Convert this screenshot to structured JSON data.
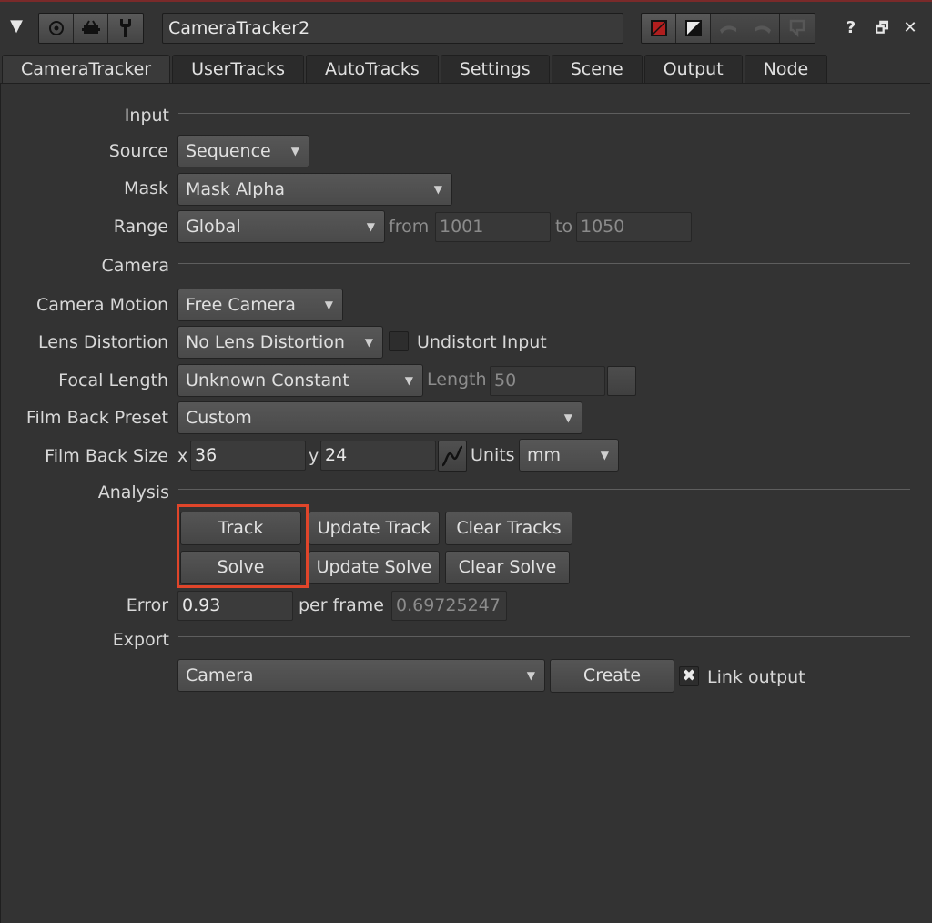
{
  "node_name": "CameraTracker2",
  "toolbar": {
    "collapse_glyph": "▼",
    "group_left": [
      "settings-circle-icon",
      "viewer-icon",
      "wrench-icon"
    ],
    "group_right": [
      "red-color-swatch-icon",
      "toggle-icon",
      "undo-icon",
      "redo-icon",
      "revert-icon"
    ],
    "help_glyph": "?",
    "float_glyph": "🗗",
    "close_glyph": "✕"
  },
  "tabs": [
    "CameraTracker",
    "UserTracks",
    "AutoTracks",
    "Settings",
    "Scene",
    "Output",
    "Node"
  ],
  "input": {
    "section": "Input",
    "source_label": "Source",
    "source_value": "Sequence",
    "mask_label": "Mask",
    "mask_value": "Mask Alpha",
    "range_label": "Range",
    "range_value": "Global",
    "from_label": "from",
    "from_value": "1001",
    "to_label": "to",
    "to_value": "1050"
  },
  "camera": {
    "section": "Camera",
    "motion_label": "Camera Motion",
    "motion_value": "Free Camera",
    "lens_label": "Lens Distortion",
    "lens_value": "No Lens Distortion",
    "undistort_label": "Undistort Input",
    "focal_label": "Focal Length",
    "focal_value": "Unknown Constant",
    "length_label": "Length",
    "length_value": "50",
    "filmback_label": "Film Back Preset",
    "filmback_value": "Custom",
    "size_label": "Film Back Size",
    "x_label": "x",
    "x_value": "36",
    "y_label": "y",
    "y_value": "24",
    "units_label": "Units",
    "units_value": "mm"
  },
  "analysis": {
    "section": "Analysis",
    "track": "Track",
    "update_track": "Update Track",
    "clear_tracks": "Clear Tracks",
    "solve": "Solve",
    "update_solve": "Update Solve",
    "clear_solve": "Clear Solve",
    "error_label": "Error",
    "error_value": "0.93",
    "per_frame_label": "per frame",
    "per_frame_value": "0.69725247"
  },
  "export": {
    "section": "Export",
    "type_value": "Camera",
    "create": "Create",
    "link_label": "Link output"
  },
  "colors": {
    "highlight": "#e0452a",
    "background": "#333333"
  }
}
